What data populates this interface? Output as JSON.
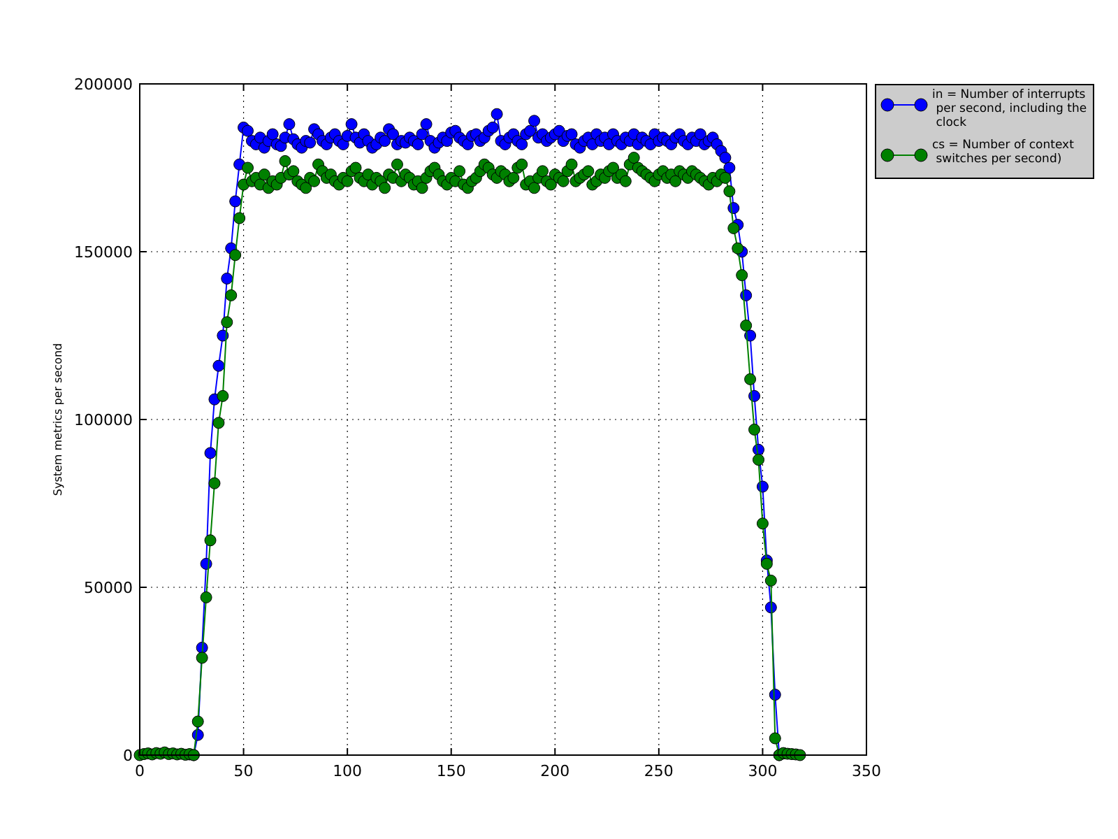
{
  "chart_data": {
    "type": "line",
    "grid": true,
    "ylabel": "System metrics per second",
    "x": [
      0,
      2,
      4,
      6,
      8,
      10,
      12,
      14,
      16,
      18,
      20,
      22,
      24,
      26,
      28,
      30,
      32,
      34,
      36,
      38,
      40,
      42,
      44,
      46,
      48,
      50,
      52,
      54,
      56,
      58,
      60,
      62,
      64,
      66,
      68,
      70,
      72,
      74,
      76,
      78,
      80,
      82,
      84,
      86,
      88,
      90,
      92,
      94,
      96,
      98,
      100,
      102,
      104,
      106,
      108,
      110,
      112,
      114,
      116,
      118,
      120,
      122,
      124,
      126,
      128,
      130,
      132,
      134,
      136,
      138,
      140,
      142,
      144,
      146,
      148,
      150,
      152,
      154,
      156,
      158,
      160,
      162,
      164,
      166,
      168,
      170,
      172,
      174,
      176,
      178,
      180,
      182,
      184,
      186,
      188,
      190,
      192,
      194,
      196,
      198,
      200,
      202,
      204,
      206,
      208,
      210,
      212,
      214,
      216,
      218,
      220,
      222,
      224,
      226,
      228,
      230,
      232,
      234,
      236,
      238,
      240,
      242,
      244,
      246,
      248,
      250,
      252,
      254,
      256,
      258,
      260,
      262,
      264,
      266,
      268,
      270,
      272,
      274,
      276,
      278,
      280,
      282,
      284,
      286,
      288,
      290,
      292,
      294,
      296,
      298,
      300,
      302,
      304,
      306,
      308,
      310,
      312,
      314,
      316,
      318
    ],
    "xlim": [
      0,
      350
    ],
    "ylim": [
      0,
      200000
    ],
    "xticks": [
      0,
      50,
      100,
      150,
      200,
      250,
      300,
      350
    ],
    "yticks": [
      0,
      50000,
      100000,
      150000,
      200000
    ],
    "series": [
      {
        "name": "in = Number of interrupts\n per second, including the\n clock",
        "color": "#0000ff",
        "marker": "o",
        "values": [
          null,
          null,
          null,
          null,
          null,
          null,
          null,
          null,
          null,
          null,
          null,
          null,
          200,
          0,
          6000,
          32000,
          57000,
          90000,
          106000,
          116000,
          125000,
          142000,
          151000,
          165000,
          176000,
          187000,
          186000,
          183000,
          182000,
          184000,
          181000,
          183000,
          185000,
          182000,
          181500,
          184000,
          188000,
          183500,
          182000,
          181000,
          183000,
          182500,
          186500,
          185000,
          183000,
          182000,
          184000,
          185000,
          183000,
          182000,
          184500,
          188000,
          184000,
          182500,
          185000,
          183000,
          181000,
          182000,
          184000,
          183000,
          186500,
          185000,
          182000,
          183000,
          182500,
          184000,
          183000,
          182000,
          185000,
          188000,
          183000,
          181000,
          182500,
          184000,
          183000,
          185500,
          186000,
          184000,
          183000,
          182000,
          184500,
          185000,
          183000,
          184000,
          186000,
          187000,
          191000,
          183000,
          182000,
          184000,
          185000,
          183000,
          182000,
          185000,
          186000,
          189000,
          184000,
          185000,
          183000,
          184000,
          185000,
          186000,
          183000,
          184500,
          185000,
          182000,
          181000,
          183000,
          184000,
          182000,
          185000,
          183000,
          184000,
          182000,
          185000,
          183000,
          182000,
          184000,
          183000,
          185000,
          182000,
          184000,
          183000,
          182000,
          185000,
          183000,
          184000,
          183000,
          182000,
          184000,
          185000,
          183000,
          182000,
          184000,
          183000,
          185000,
          182000,
          183000,
          184000,
          182000,
          180000,
          178000,
          175000,
          163000,
          158000,
          150000,
          137000,
          125000,
          107000,
          91000,
          80000,
          58000,
          44000,
          18000,
          0,
          500,
          null,
          null,
          null,
          null
        ]
      },
      {
        "name": "cs = Number of context\n switches per second)",
        "color": "#008000",
        "marker": "o",
        "values": [
          0,
          300,
          500,
          200,
          600,
          400,
          800,
          300,
          500,
          200,
          400,
          100,
          300,
          0,
          10000,
          29000,
          47000,
          64000,
          81000,
          99000,
          107000,
          129000,
          137000,
          149000,
          160000,
          170000,
          175000,
          171000,
          172000,
          170000,
          173000,
          169000,
          171000,
          170000,
          172000,
          177000,
          173000,
          174000,
          171000,
          170000,
          169000,
          172000,
          171000,
          176000,
          174000,
          172000,
          173000,
          171000,
          170000,
          172000,
          171000,
          174000,
          175000,
          172000,
          171000,
          173000,
          170000,
          172000,
          171000,
          169000,
          173000,
          172000,
          176000,
          171000,
          173000,
          172000,
          170000,
          171000,
          169000,
          172000,
          174000,
          175000,
          173000,
          171000,
          170000,
          172000,
          171000,
          174000,
          170000,
          169000,
          171000,
          172000,
          174000,
          176000,
          175000,
          173000,
          172000,
          174000,
          173000,
          171000,
          172000,
          175000,
          176000,
          170000,
          171000,
          169000,
          172000,
          174000,
          171000,
          170000,
          173000,
          172000,
          171000,
          174000,
          176000,
          171000,
          172000,
          173000,
          174000,
          170000,
          171000,
          173000,
          172000,
          174000,
          175000,
          172000,
          173000,
          171000,
          176000,
          178000,
          175000,
          174000,
          173000,
          172000,
          171000,
          173000,
          174000,
          172000,
          173000,
          171000,
          174000,
          173000,
          172000,
          174000,
          173000,
          172000,
          171000,
          170000,
          172000,
          171000,
          173000,
          172000,
          168000,
          157000,
          151000,
          143000,
          128000,
          112000,
          97000,
          88000,
          69000,
          57000,
          52000,
          5000,
          0,
          600,
          400,
          300,
          200,
          0
        ]
      }
    ]
  }
}
